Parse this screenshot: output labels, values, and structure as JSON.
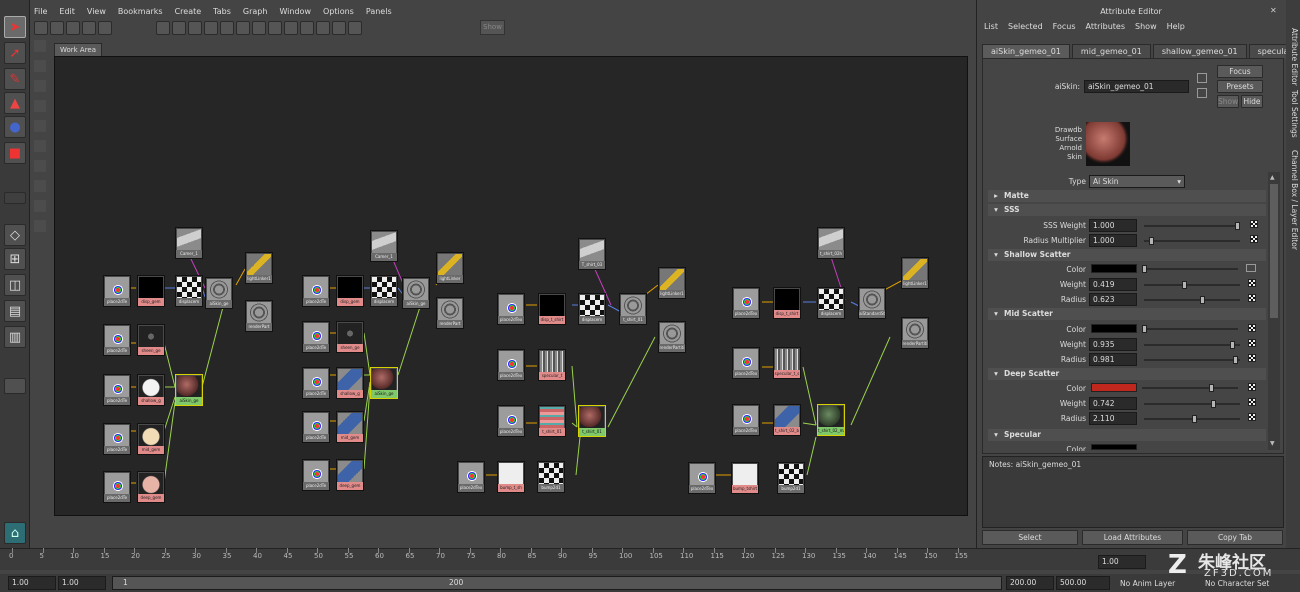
{
  "hypershade": {
    "menu": [
      "File",
      "Edit",
      "View",
      "Bookmarks",
      "Create",
      "Tabs",
      "Graph",
      "Window",
      "Options",
      "Panels"
    ],
    "show_label": "Show",
    "tab_label": "Work Area",
    "nodes": [
      {
        "id": "n1",
        "label": "Camer_1",
        "style": "gy cam"
      },
      {
        "id": "n2",
        "label": "lightLinker1",
        "style": "gy lamp"
      },
      {
        "id": "n3",
        "label": "place2dTe",
        "style": "gy pl"
      },
      {
        "id": "n4",
        "label": "disp_gem",
        "style": "tx blk"
      },
      {
        "id": "n5",
        "label": "displacem",
        "style": "gy chk"
      },
      {
        "id": "n6",
        "label": "aiSkin_ge",
        "style": "gy ring"
      },
      {
        "id": "n7",
        "label": "renderPart",
        "style": "gy ring"
      },
      {
        "id": "n8",
        "label": "place2dTe",
        "style": "gy pl"
      },
      {
        "id": "n9",
        "label": "sheen_ge",
        "style": "tx spot"
      },
      {
        "id": "n10",
        "label": "place2dTe",
        "style": "gy pl"
      },
      {
        "id": "n11",
        "label": "shallow_g",
        "style": "tx patchw"
      },
      {
        "id": "n12",
        "label": "aiSkin_ge",
        "style": "sh ball"
      },
      {
        "id": "n13",
        "label": "place2dTe",
        "style": "gy pl"
      },
      {
        "id": "n14",
        "label": "mid_gem",
        "style": "tx patch"
      },
      {
        "id": "n15",
        "label": "place2dTe",
        "style": "gy pl"
      },
      {
        "id": "n16",
        "label": "deep_gem",
        "style": "tx patchp"
      },
      {
        "id": "n17",
        "label": "Camer_1",
        "style": "gy cam"
      },
      {
        "id": "n18",
        "label": "lightLinker",
        "style": "gy lamp"
      },
      {
        "id": "n19",
        "label": "place2dTe",
        "style": "gy pl"
      },
      {
        "id": "n20",
        "label": "disp_gem",
        "style": "tx blk"
      },
      {
        "id": "n21",
        "label": "displacem",
        "style": "gy chk"
      },
      {
        "id": "n22",
        "label": "aiSkin_ge",
        "style": "gy ring"
      },
      {
        "id": "n23",
        "label": "renderPart",
        "style": "gy ring"
      },
      {
        "id": "n24",
        "label": "place2dTe",
        "style": "gy pl"
      },
      {
        "id": "n25",
        "label": "sheen_ge",
        "style": "tx spot"
      },
      {
        "id": "n26",
        "label": "place2dTe",
        "style": "gy pl"
      },
      {
        "id": "n27",
        "label": "shallow_g",
        "style": "tx blue"
      },
      {
        "id": "n28",
        "label": "aiSkin_ge",
        "style": "sh ball"
      },
      {
        "id": "n29",
        "label": "place2dTe",
        "style": "gy pl"
      },
      {
        "id": "n30",
        "label": "mid_gem",
        "style": "tx blue"
      },
      {
        "id": "n31",
        "label": "place2dTe",
        "style": "gy pl"
      },
      {
        "id": "n32",
        "label": "deep_gem",
        "style": "tx blue"
      },
      {
        "id": "n33",
        "label": "T_shirt_03",
        "style": "gy cam"
      },
      {
        "id": "n34",
        "label": "lightLinker1",
        "style": "gy lamp"
      },
      {
        "id": "n35",
        "label": "place2dTex",
        "style": "gy pl"
      },
      {
        "id": "n36",
        "label": "disp_t_shirt",
        "style": "tx blk"
      },
      {
        "id": "n37",
        "label": "displacem",
        "style": "gy chk"
      },
      {
        "id": "n38",
        "label": "t_shirt_01",
        "style": "gy ring"
      },
      {
        "id": "n39",
        "label": "renderPartiti",
        "style": "gy ring"
      },
      {
        "id": "n40",
        "label": "place2dTex",
        "style": "gy pl"
      },
      {
        "id": "n41",
        "label": "specular_t",
        "style": "tx noise"
      },
      {
        "id": "n42",
        "label": "place2dTex",
        "style": "gy pl"
      },
      {
        "id": "n43",
        "label": "t_shirt_01",
        "style": "tx stripe"
      },
      {
        "id": "n44",
        "label": "t_shirt_01",
        "style": "sh ball"
      },
      {
        "id": "n45",
        "label": "place2dTex",
        "style": "gy pl"
      },
      {
        "id": "n46",
        "label": "bump_t_sh",
        "style": "tx pale"
      },
      {
        "id": "n47",
        "label": "bump2d1",
        "style": "gy chk"
      },
      {
        "id": "n48",
        "label": "t_shirt_02h",
        "style": "gy cam"
      },
      {
        "id": "n49",
        "label": "lightLinker1",
        "style": "gy lamp"
      },
      {
        "id": "n50",
        "label": "place2dTex",
        "style": "gy pl"
      },
      {
        "id": "n51",
        "label": "disp_t_shirt",
        "style": "tx blk"
      },
      {
        "id": "n52",
        "label": "displacem",
        "style": "gy chk"
      },
      {
        "id": "n53",
        "label": "aiStandardSt",
        "style": "gy ring"
      },
      {
        "id": "n54",
        "label": "renderPartiti",
        "style": "gy ring"
      },
      {
        "id": "n55",
        "label": "place2dTex",
        "style": "gy pl"
      },
      {
        "id": "n56",
        "label": "specular_t_s",
        "style": "tx noise"
      },
      {
        "id": "n57",
        "label": "place2dTex",
        "style": "gy pl"
      },
      {
        "id": "n58",
        "label": "t_shirt_02_b",
        "style": "tx blue"
      },
      {
        "id": "n59",
        "label": "t_shirt_02_ma",
        "style": "sh ballg"
      },
      {
        "id": "n60",
        "label": "place2dTex",
        "style": "gy pl"
      },
      {
        "id": "n61",
        "label": "bump_tshirt",
        "style": "tx pale"
      },
      {
        "id": "n62",
        "label": "bump2d1",
        "style": "gy chk"
      }
    ]
  },
  "attribute_editor": {
    "title": "Attribute Editor",
    "close_glyph": "✕",
    "menu": [
      "List",
      "Selected",
      "Focus",
      "Attributes",
      "Show",
      "Help"
    ],
    "tabs": [
      "aiSkin_gemeo_01",
      "mid_gemeo_01",
      "shallow_gemeo_01",
      "specular_"
    ],
    "node_type_label": "aiSkin:",
    "node_name": "aiSkin_gemeo_01",
    "buttons": {
      "focus": "Focus",
      "presets": "Presets",
      "show": "Show",
      "hide": "Hide"
    },
    "swatch_caption": [
      "Drawdb",
      "Surface",
      "Arnold",
      "Skin"
    ],
    "type_label": "Type",
    "type_value": "Ai Skin",
    "sections": [
      {
        "name": "Matte",
        "open": false
      },
      {
        "name": "SSS",
        "open": true
      },
      {
        "name": "Shallow Scatter",
        "open": true
      },
      {
        "name": "Mid Scatter",
        "open": true
      },
      {
        "name": "Deep Scatter",
        "open": true
      },
      {
        "name": "Specular",
        "open": true
      }
    ],
    "attrs": {
      "sss_weight": {
        "label": "SSS Weight",
        "value": "1.000",
        "level": 1.0
      },
      "radius_multiplier": {
        "label": "Radius Multiplier",
        "value": "1.000",
        "level": 0.05
      },
      "shallow_color": {
        "label": "Color",
        "color": "#000000",
        "level": 0.0
      },
      "shallow_weight": {
        "label": "Weight",
        "value": "0.419",
        "level": 0.42
      },
      "shallow_radius": {
        "label": "Radius",
        "value": "0.623",
        "level": 0.62
      },
      "mid_color": {
        "label": "Color",
        "color": "#000000",
        "level": 0.0
      },
      "mid_weight": {
        "label": "Weight",
        "value": "0.935",
        "level": 0.94
      },
      "mid_radius": {
        "label": "Radius",
        "value": "0.981",
        "level": 0.98
      },
      "deep_color": {
        "label": "Color",
        "color": "#c0281e",
        "level": 0.74
      },
      "deep_weight": {
        "label": "Weight",
        "value": "0.742",
        "level": 0.74
      },
      "deep_radius": {
        "label": "Radius",
        "value": "2.110",
        "level": 0.53
      },
      "spec_color": {
        "label": "Color",
        "color": "#000000"
      }
    },
    "notes_label": "Notes:  aiSkin_gemeo_01",
    "bottom_buttons": [
      "Select",
      "Load Attributes",
      "Copy Tab"
    ]
  },
  "side_tabs": [
    "Attribute Editor",
    "Tool Settings",
    "Channel Box / Layer Editor"
  ],
  "timeline": {
    "ticks": [
      "0",
      "5",
      "10",
      "15",
      "20",
      "25",
      "30",
      "35",
      "40",
      "45",
      "50",
      "55",
      "60",
      "65",
      "70",
      "75",
      "80",
      "85",
      "90",
      "95",
      "100",
      "105",
      "110",
      "115",
      "120",
      "125",
      "130",
      "135",
      "140",
      "145",
      "150",
      "155"
    ],
    "current_frame": "1.00"
  },
  "range": {
    "start": "1.00",
    "start2": "1.00",
    "slider_start": "1",
    "slider_end": "200",
    "end": "200.00",
    "end2": "500.00",
    "anim_layer": "No Anim Layer",
    "char_set": "No Character Set"
  },
  "watermark": {
    "brand": "朱峰社区",
    "url": "ZF3D.COM"
  }
}
